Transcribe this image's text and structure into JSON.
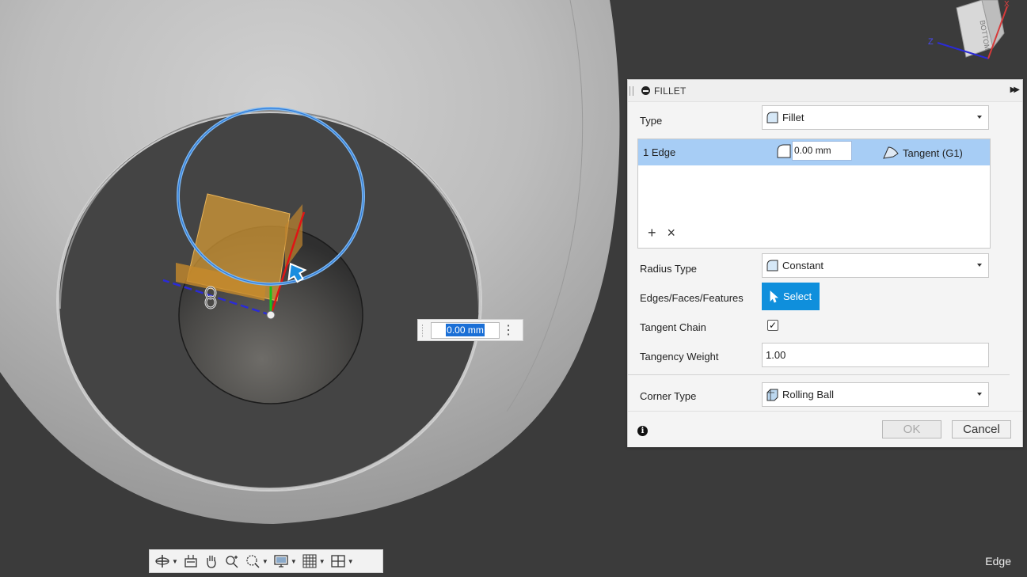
{
  "dialog": {
    "title": "FILLET",
    "type_label": "Type",
    "type_value": "Fillet",
    "edge_row": {
      "name": "1 Edge",
      "radius": "0.00 mm",
      "tangency": "Tangent (G1)"
    },
    "table_add": "+",
    "table_remove": "×",
    "radius_type_label": "Radius Type",
    "radius_type_value": "Constant",
    "edges_label": "Edges/Faces/Features",
    "select_label": "Select",
    "tangent_chain_label": "Tangent Chain",
    "tangent_chain_checked": "✓",
    "tangency_weight_label": "Tangency Weight",
    "tangency_weight_value": "1.00",
    "corner_type_label": "Corner Type",
    "corner_type_value": "Rolling Ball",
    "ok_label": "OK",
    "cancel_label": "Cancel"
  },
  "viewport": {
    "radius_input_value": "0.00 mm",
    "viewcube_face": "BOTTOM",
    "axis_z": "Z",
    "axis_x": "X",
    "status": "Edge"
  },
  "toolbar": {
    "items": [
      "orbit-icon",
      "look-at-icon",
      "pan-icon",
      "zoom-icon",
      "fit-icon",
      "display-settings-icon",
      "grid-icon",
      "viewports-icon"
    ]
  },
  "colors": {
    "accent_blue": "#0f8fdc",
    "selection_row": "#a7cdf5",
    "viewport_bg": "#3a3a3a"
  }
}
